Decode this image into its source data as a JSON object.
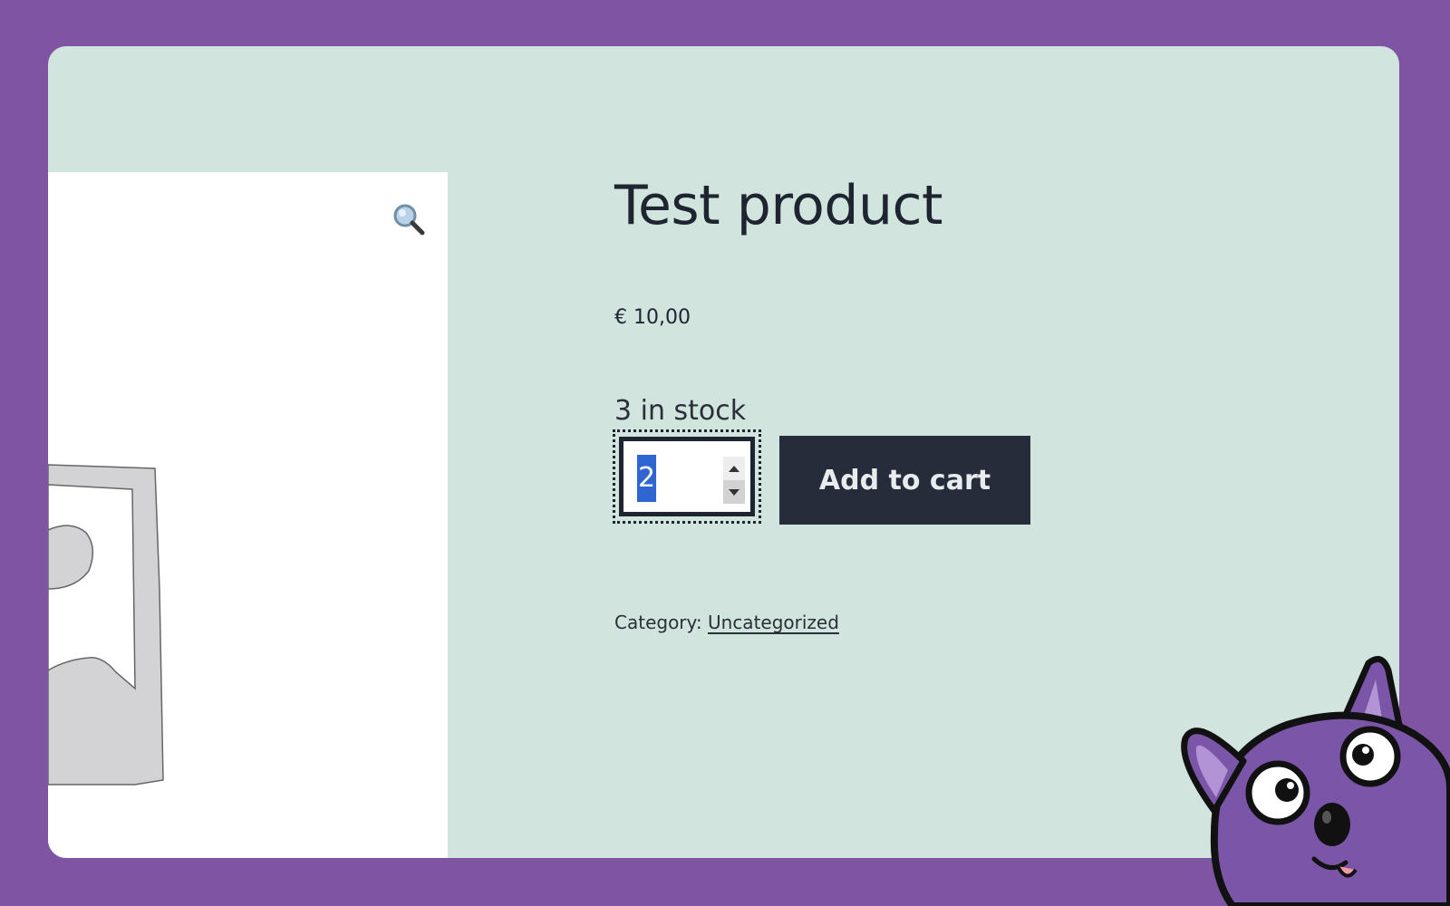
{
  "product": {
    "title": "Test product",
    "price": "€ 10,00",
    "stock": "3 in stock",
    "quantity": "2",
    "add_to_cart_label": "Add to cart",
    "category_label": "Category:",
    "category_link": "Uncategorized"
  },
  "icons": {
    "zoom": "magnifier-icon",
    "placeholder": "image-placeholder-icon",
    "mascot": "purple-cat-mascot"
  },
  "colors": {
    "background": "#7f54a3",
    "card": "#d1e4de",
    "button": "#262c39",
    "selection": "#2f66d3"
  }
}
